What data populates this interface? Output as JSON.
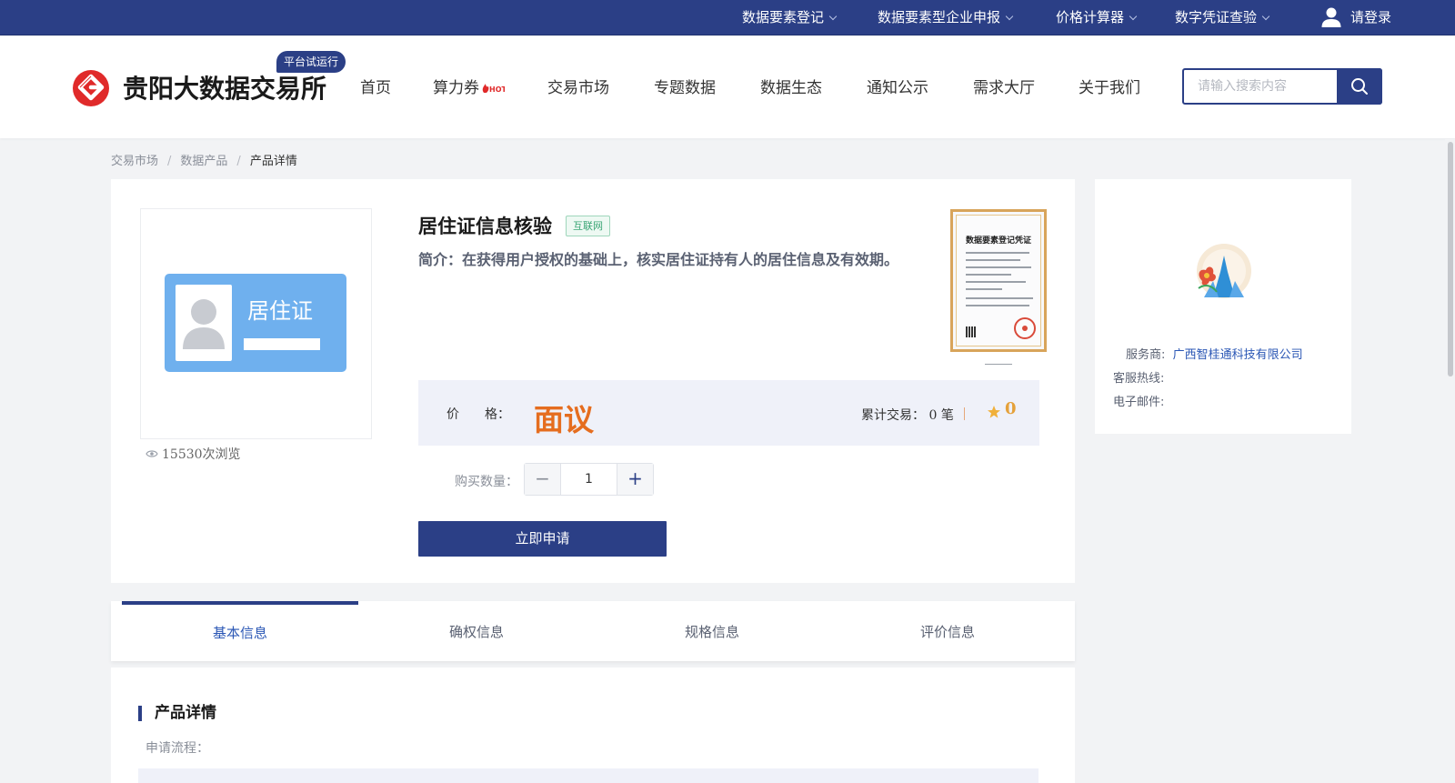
{
  "topbar": {
    "links": [
      "数据要素登记",
      "数据要素型企业申报",
      "价格计算器",
      "数字凭证查验"
    ],
    "login": "请登录"
  },
  "header": {
    "logo_text": "贵阳大数据交易所",
    "trial_badge": "平台试运行",
    "nav": [
      "首页",
      "算力券",
      "交易市场",
      "专题数据",
      "数据生态",
      "通知公示",
      "需求大厅",
      "关于我们"
    ],
    "search_placeholder": "请输入搜索内容"
  },
  "breadcrumb": [
    "交易市场",
    "数据产品",
    "产品详情"
  ],
  "product": {
    "title": "居住证信息核验",
    "tag": "互联网",
    "intro": "简介：在获得用户授权的基础上，核实居住证持有人的居住信息及有效期。",
    "image_text": "居住证",
    "views": "15530次浏览",
    "certificate_title": "数据要素登记凭证",
    "price_label": "价　　格：",
    "price_value": "面议",
    "trade_label": "累计交易：",
    "trade_count": "0",
    "trade_unit": "笔",
    "score": "0",
    "qty_label": "购买数量：",
    "qty_value": "1",
    "apply_button": "立即申请"
  },
  "provider": {
    "label_provider": "服务商:",
    "provider_name": "广西智桂通科技有限公司",
    "label_hotline": "客服热线:",
    "label_email": "电子邮件:"
  },
  "tabs": [
    "基本信息",
    "确权信息",
    "规格信息",
    "评价信息"
  ],
  "detail": {
    "title": "产品详情",
    "sub": "申请流程："
  },
  "colors": {
    "brand": "#2b3f86",
    "price": "#e56d1f",
    "tag_green": "#3aa575"
  }
}
